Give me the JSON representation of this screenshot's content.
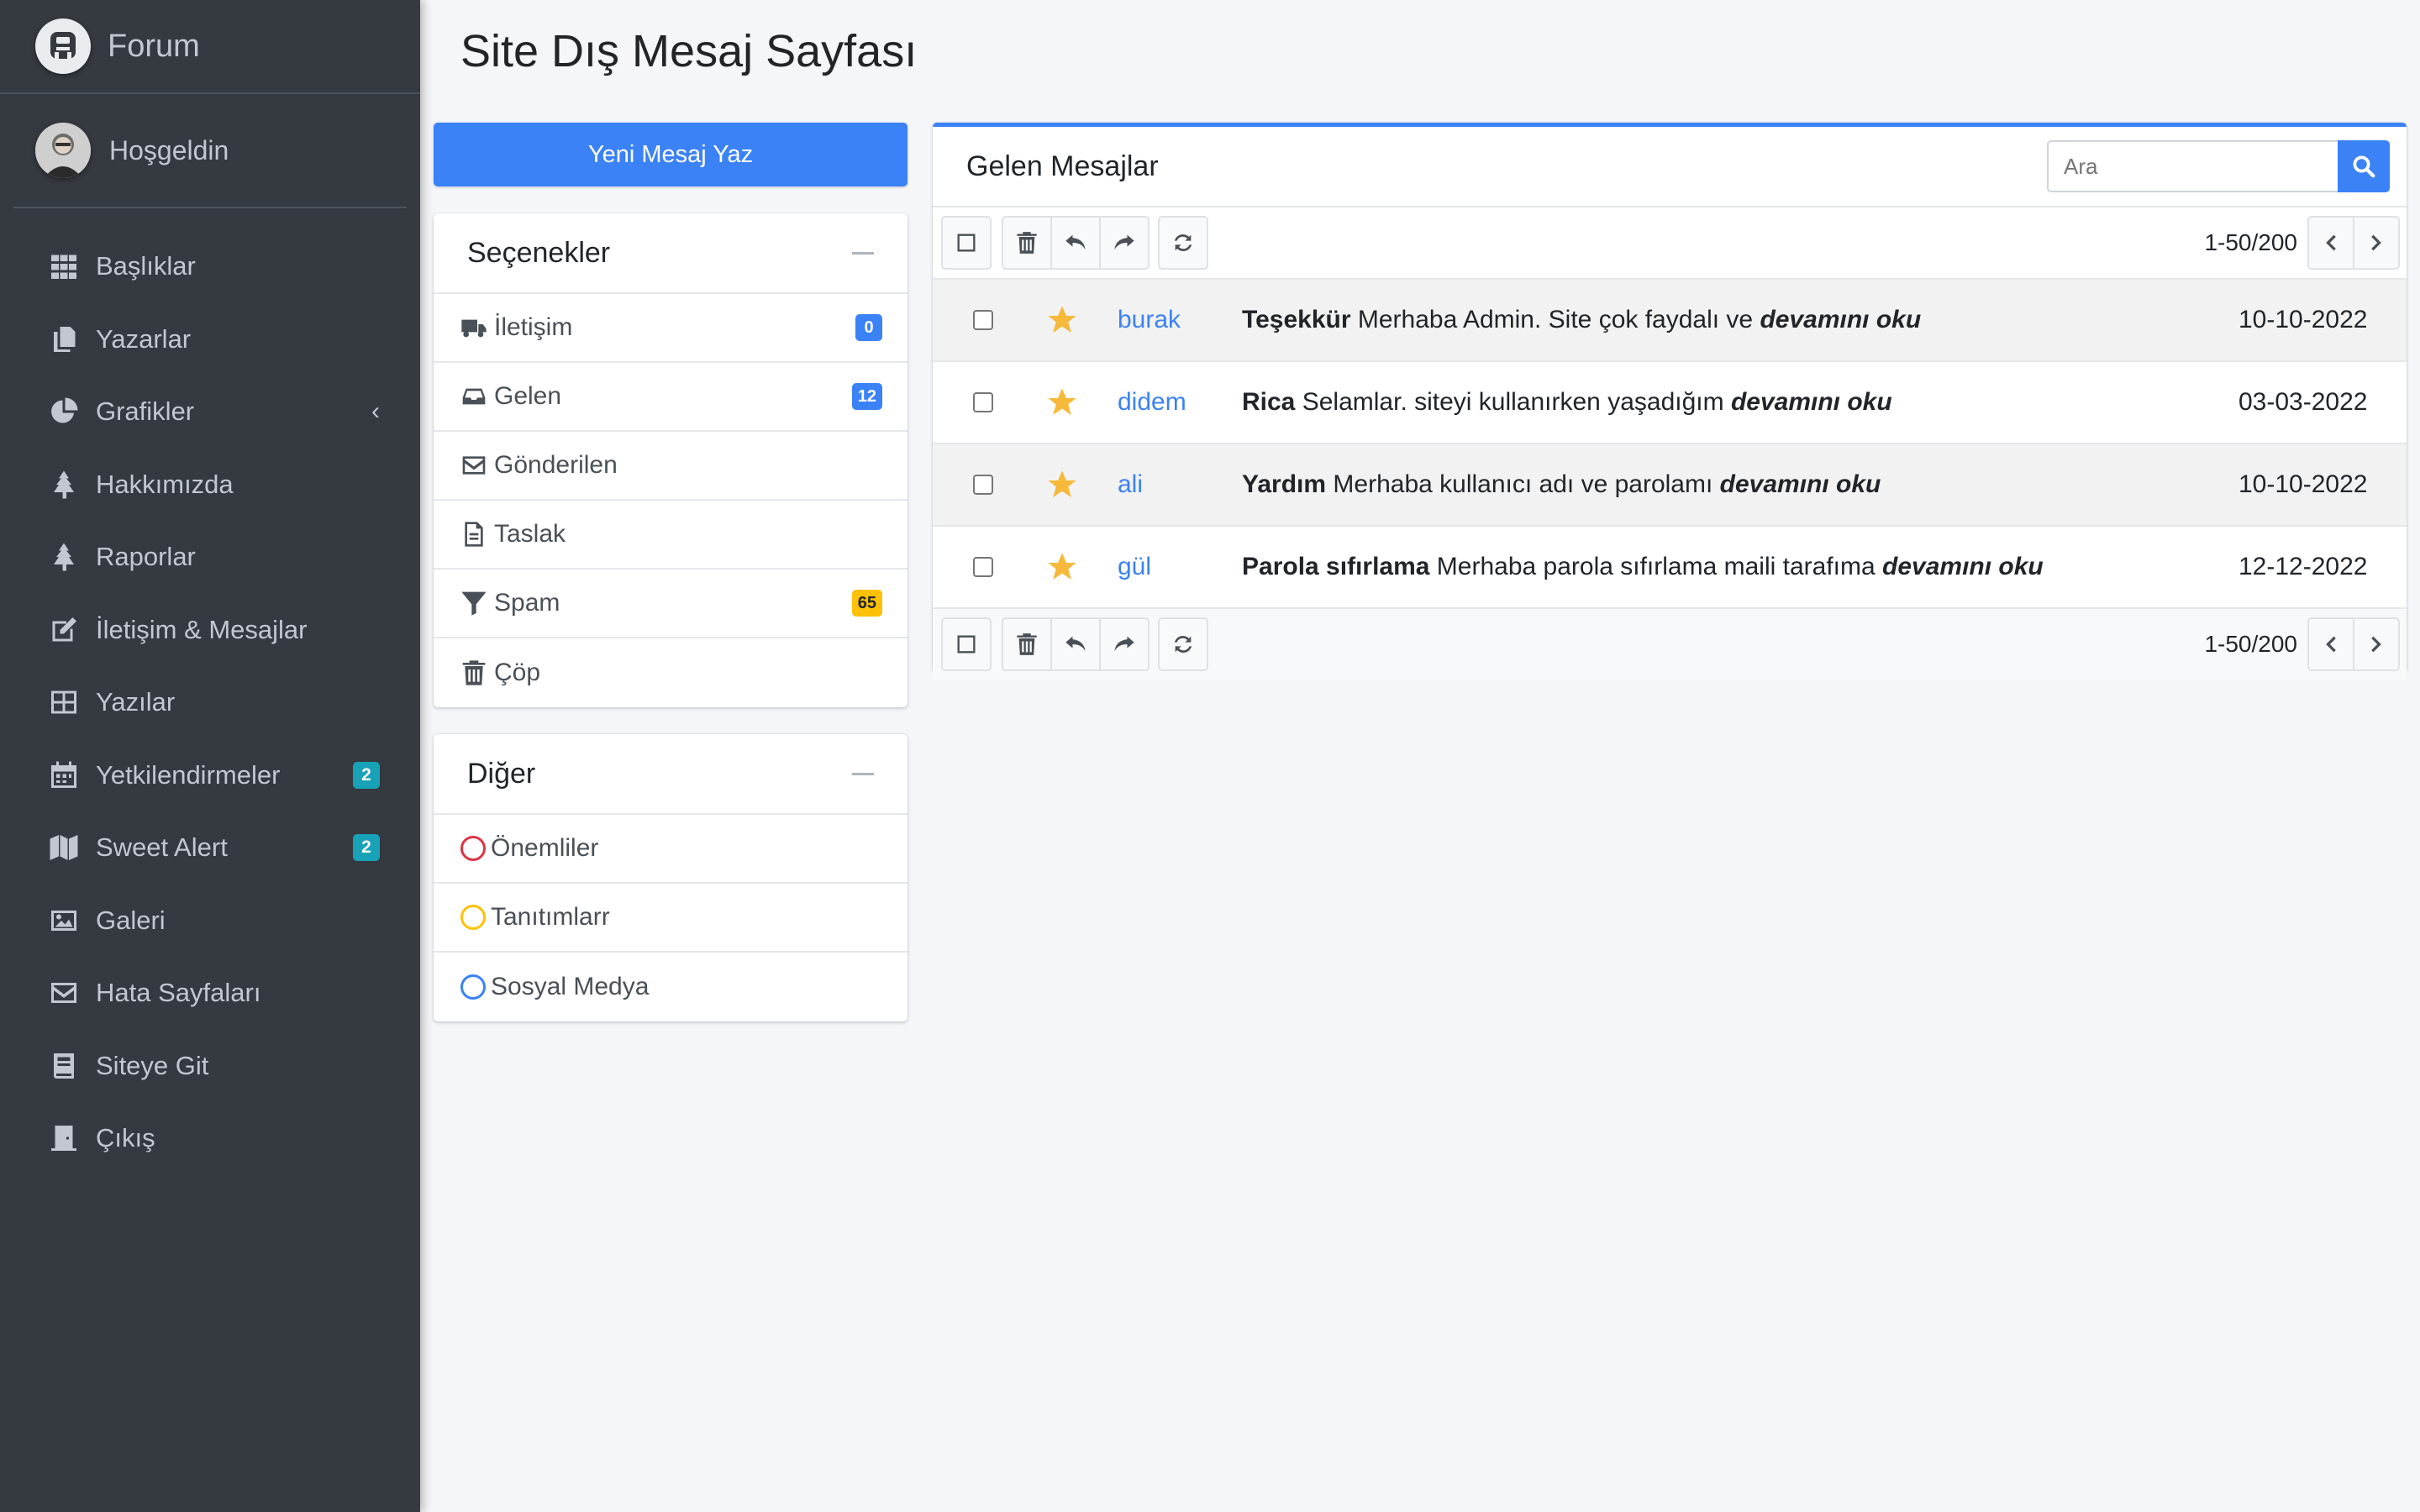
{
  "brand": {
    "text": "Forum",
    "logo_icon": "forum-logo-icon"
  },
  "user": {
    "greeting": "Hoşgeldin"
  },
  "sidebar": {
    "items": [
      {
        "label": "Başlıklar",
        "icon": "grid-icon"
      },
      {
        "label": "Yazarlar",
        "icon": "copy-icon"
      },
      {
        "label": "Grafikler",
        "icon": "pie-chart-icon",
        "chevron": "‹"
      },
      {
        "label": "Hakkımızda",
        "icon": "tree-icon"
      },
      {
        "label": "Raporlar",
        "icon": "tree-icon"
      },
      {
        "label": "İletişim & Mesajlar",
        "icon": "edit-icon"
      },
      {
        "label": "Yazılar",
        "icon": "table-icon"
      },
      {
        "label": "Yetkilendirmeler",
        "icon": "calendar-icon",
        "badge": "2"
      },
      {
        "label": "Sweet Alert",
        "icon": "map-icon",
        "badge": "2"
      },
      {
        "label": "Galeri",
        "icon": "image-icon"
      },
      {
        "label": "Hata Sayfaları",
        "icon": "envelope-icon"
      },
      {
        "label": "Siteye Git",
        "icon": "book-icon"
      },
      {
        "label": "Çıkış",
        "icon": "door-icon"
      }
    ]
  },
  "page": {
    "title": "Site Dış Mesaj Sayfası"
  },
  "compose": {
    "label": "Yeni Mesaj Yaz"
  },
  "folders": {
    "title": "Seçenekler",
    "items": [
      {
        "label": "İletişim",
        "icon": "shipping-icon",
        "badge": "0",
        "badge_color": "#3b82f6"
      },
      {
        "label": "Gelen",
        "icon": "inbox-icon",
        "badge": "12",
        "badge_color": "#3b82f6"
      },
      {
        "label": "Gönderilen",
        "icon": "envelope-icon"
      },
      {
        "label": "Taslak",
        "icon": "file-icon"
      },
      {
        "label": "Spam",
        "icon": "filter-icon",
        "badge": "65",
        "badge_color": "#ffc107"
      },
      {
        "label": "Çöp",
        "icon": "trash-icon"
      }
    ]
  },
  "labels": {
    "title": "Diğer",
    "items": [
      {
        "label": "Önemliler",
        "color": "#dc3545"
      },
      {
        "label": "Tanıtımlarr",
        "color": "#ffc107"
      },
      {
        "label": "Sosyal Medya",
        "color": "#3b82f6"
      }
    ]
  },
  "inbox": {
    "title": "Gelen Mesajlar",
    "search_placeholder": "Ara",
    "pager": "1-50/200",
    "messages": [
      {
        "sender": "burak",
        "subject": "Teşekkür",
        "preview": "Merhaba Admin. Site çok faydalı ve",
        "more": "devamını oku",
        "date": "10-10-2022"
      },
      {
        "sender": "didem",
        "subject": "Rica",
        "preview": "Selamlar. siteyi kullanırken yaşadığım",
        "more": "devamını oku",
        "date": "03-03-2022"
      },
      {
        "sender": "ali",
        "subject": "Yardım",
        "preview": "Merhaba kullanıcı adı ve parolamı",
        "more": "devamını oku",
        "date": "10-10-2022"
      },
      {
        "sender": "gül",
        "subject": "Parola sıfırlama",
        "preview": "Merhaba parola sıfırlama maili tarafıma",
        "more": "devamını oku",
        "date": "12-12-2022"
      }
    ]
  },
  "colors": {
    "sidebar_bg": "#343a40",
    "primary": "#3b82f6",
    "star": "#f6b93b",
    "background": "#f4f6f9"
  }
}
